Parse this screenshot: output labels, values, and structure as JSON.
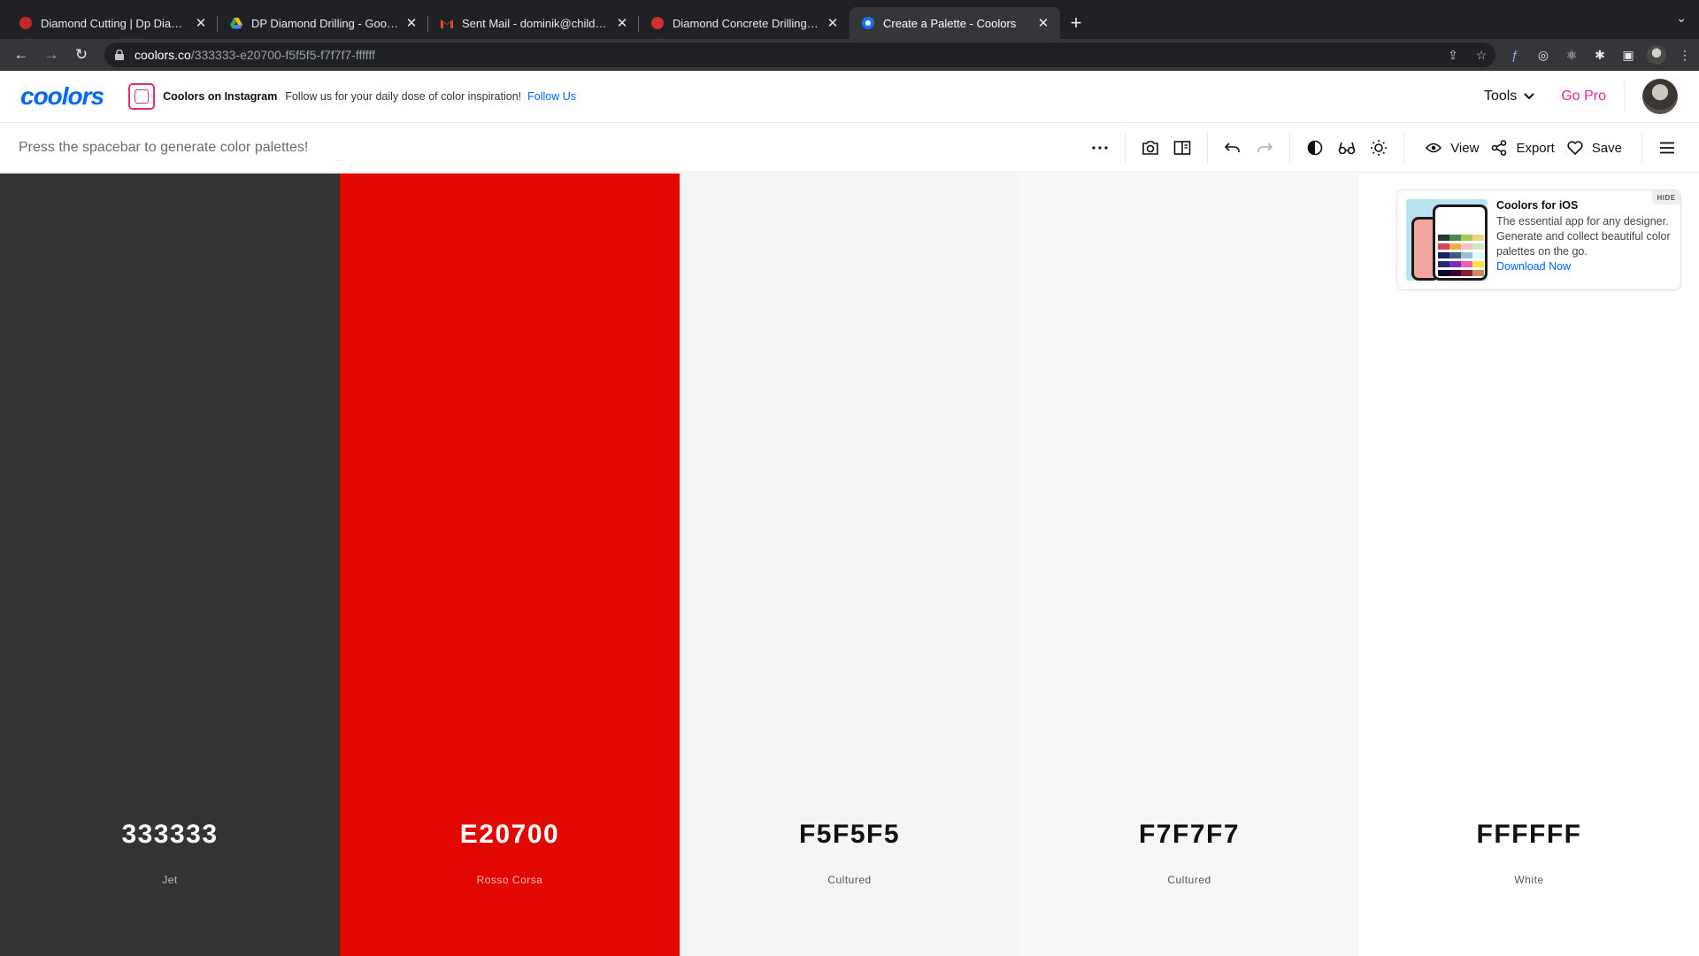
{
  "browser": {
    "tabs": [
      {
        "title": "Diamond Cutting | Dp Diamond",
        "favicon_color": "#c62828",
        "active": false
      },
      {
        "title": "DP Diamond Drilling - Google D",
        "favicon_color": "#34a853",
        "active": false
      },
      {
        "title": "Sent Mail - dominik@childsey.c",
        "favicon_color": "#ea4335",
        "active": false
      },
      {
        "title": "Diamond Concrete Drilling & Su",
        "favicon_color": "#d32f2f",
        "active": false
      },
      {
        "title": "Create a Palette - Coolors",
        "favicon_color": "#1a73e8",
        "active": true
      }
    ],
    "url_host": "coolors.co",
    "url_path": "/333333-e20700-f5f5f5-f7f7f7-ffffff"
  },
  "header": {
    "logo_text": "coolors",
    "promo_title": "Coolors on Instagram",
    "promo_text": "Follow us for your daily dose of color inspiration!",
    "promo_link": "Follow Us",
    "tools_label": "Tools",
    "gopro_label": "Go Pro"
  },
  "toolbar": {
    "hint": "Press the spacebar to generate color palettes!",
    "view_label": "View",
    "export_label": "Export",
    "save_label": "Save"
  },
  "palette": [
    {
      "hex": "333333",
      "name": "Jet",
      "bg": "#333333",
      "fg": "#ffffff",
      "sub": "#bdbdbd"
    },
    {
      "hex": "E20700",
      "name": "Rosso Corsa",
      "bg": "#E20700",
      "fg": "#ffffff",
      "sub": "#f5b5b3"
    },
    {
      "hex": "F5F5F5",
      "name": "Cultured",
      "bg": "#F5F5F5",
      "fg": "#111111",
      "sub": "#555555"
    },
    {
      "hex": "F7F7F7",
      "name": "Cultured",
      "bg": "#F7F7F7",
      "fg": "#111111",
      "sub": "#555555"
    },
    {
      "hex": "FFFFFF",
      "name": "White",
      "bg": "#FFFFFF",
      "fg": "#111111",
      "sub": "#555555"
    }
  ],
  "ad": {
    "title": "Coolors for iOS",
    "description": "The essential app for any designer. Generate and collect beautiful color palettes on the go.",
    "link": "Download Now",
    "hide_label": "HIDE"
  }
}
